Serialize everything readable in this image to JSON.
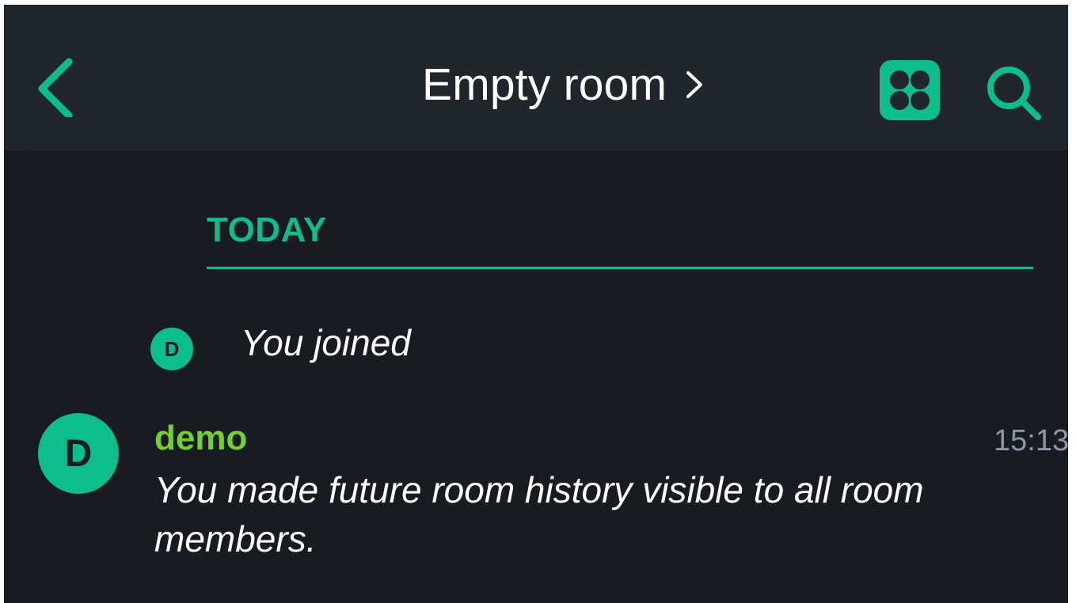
{
  "header": {
    "title": "Empty room",
    "back_icon": "chevron-left-icon",
    "title_chevron_icon": "chevron-right-icon",
    "widgets_icon": "widgets-grid-icon",
    "search_icon": "search-icon"
  },
  "timeline": {
    "date_separator": "TODAY",
    "events": [
      {
        "type": "membership",
        "avatar_initial": "D",
        "text": "You joined"
      },
      {
        "type": "message",
        "avatar_initial": "D",
        "sender": "demo",
        "time": "15:13",
        "body": "You made future room history visible to all room members."
      }
    ]
  },
  "colors": {
    "accent": "#0dbd8b",
    "sender_name": "#74d12c",
    "header_bg": "#21262d",
    "timeline_bg": "#181b20",
    "timestamp": "#8d97a5"
  }
}
